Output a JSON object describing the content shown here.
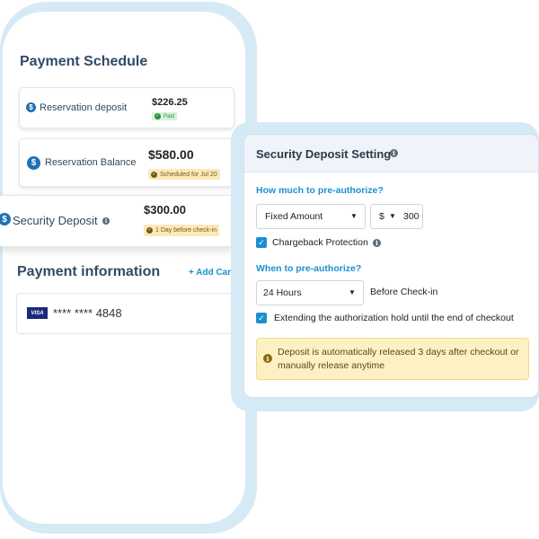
{
  "payment_schedule": {
    "title": "Payment Schedule",
    "items": [
      {
        "icon": "dollar-icon",
        "label": "Reservation deposit",
        "amount": "$226.25",
        "status": "Paid"
      },
      {
        "icon": "dollar-icon",
        "label": "Reservation Balance",
        "amount": "$580.00",
        "status": "Scheduled for Jul 20"
      },
      {
        "icon": "dollar-icon",
        "label": "Security Deposit",
        "amount": "$300.00",
        "status": "1 Day before check-in"
      }
    ]
  },
  "payment_info": {
    "title": "Payment information",
    "add_card": "+ Add Card",
    "card_brand": "VISA",
    "card_number": "**** **** 4848"
  },
  "security_panel": {
    "title": "Security Deposit Setting",
    "how_much_label": "How much to pre-authorize?",
    "amount_type": "Fixed Amount",
    "currency": "$",
    "amount_value": "300",
    "chargeback_label": "Chargeback Protection",
    "chargeback_checked": true,
    "when_label": "When to pre-authorize?",
    "hours_option": "24 Hours",
    "before_label": "Before Check-in",
    "extend_label": "Extending the authorization hold until the end of checkout",
    "extend_checked": true,
    "notice": "Deposit is automatically released 3 days after checkout or manually release anytime"
  },
  "colors": {
    "accent": "#1c8fd1",
    "frame": "#d6eaf6",
    "paid_badge": "#d6f2d9",
    "scheduled_badge": "#fde9b8",
    "notice_bg": "#fdf1c3"
  }
}
